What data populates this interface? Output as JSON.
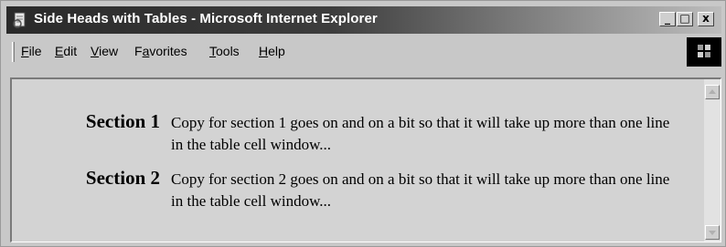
{
  "window": {
    "title": "Side Heads with Tables - Microsoft Internet Explorer",
    "buttons": {
      "minimize": "_",
      "maximize": "□",
      "close": "x"
    }
  },
  "menu": {
    "items": [
      {
        "underline": "F",
        "rest": "ile"
      },
      {
        "underline": "E",
        "rest": "dit"
      },
      {
        "underline": "V",
        "rest": "iew"
      },
      {
        "pre": "F",
        "underline": "a",
        "rest": "vorites"
      },
      {
        "underline": "T",
        "rest": "ools"
      },
      {
        "underline": "H",
        "rest": "elp"
      }
    ]
  },
  "content": {
    "sections": [
      {
        "heading": "Section 1",
        "copy": "Copy for section 1 goes on and on a bit so that it will take up more than one line in the table cell window..."
      },
      {
        "heading": "Section 2",
        "copy": "Copy for section 2 goes on and on a bit so that it will take up more than one line in the table cell window..."
      }
    ]
  },
  "icons": {
    "app": "ie-page-icon",
    "throbber": "windows-logo-icon",
    "scroll_up": "scroll-up-arrow-icon",
    "scroll_down": "scroll-down-arrow-icon"
  }
}
